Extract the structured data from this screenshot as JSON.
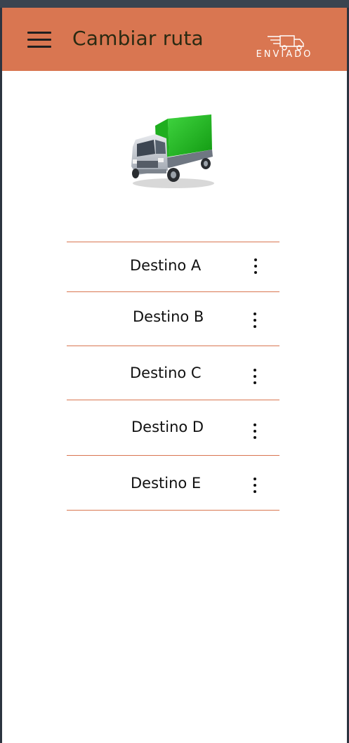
{
  "appbar": {
    "title": "Cambiar ruta",
    "logo_text": "ENVIADO",
    "background": "#d97651"
  },
  "icons": {
    "menu": "hamburger-menu-icon",
    "hero": "truck-icon",
    "row_action": "more-vertical-icon"
  },
  "destinations": [
    {
      "label": "Destino A"
    },
    {
      "label": "Destino B"
    },
    {
      "label": "Destino C"
    },
    {
      "label": "Destino D"
    },
    {
      "label": "Destino E"
    }
  ],
  "colors": {
    "accent": "#d97651",
    "truck_cargo": "#22b422"
  }
}
